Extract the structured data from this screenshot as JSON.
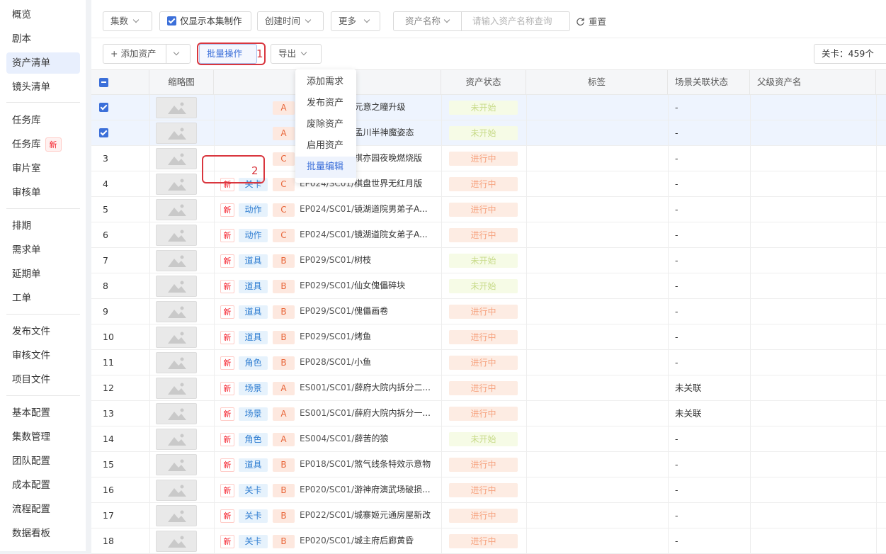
{
  "sidebar": {
    "items": [
      {
        "label": "概览"
      },
      {
        "label": "剧本"
      },
      {
        "label": "资产清单"
      },
      {
        "label": "镜头清单"
      },
      {
        "label": "任务库"
      },
      {
        "label": "任务库",
        "badge": "新"
      },
      {
        "label": "审片室"
      },
      {
        "label": "审核单"
      },
      {
        "label": "排期"
      },
      {
        "label": "需求单"
      },
      {
        "label": "延期单"
      },
      {
        "label": "工单"
      },
      {
        "label": "发布文件"
      },
      {
        "label": "审核文件"
      },
      {
        "label": "项目文件"
      },
      {
        "label": "基本配置"
      },
      {
        "label": "集数管理"
      },
      {
        "label": "团队配置"
      },
      {
        "label": "成本配置"
      },
      {
        "label": "流程配置"
      },
      {
        "label": "数据看板"
      }
    ]
  },
  "filters": {
    "episodes": "集数",
    "only_current": "仅显示本集制作",
    "created_time": "创建时间",
    "more": "更多",
    "search_field": "资产名称",
    "search_placeholder": "请输入资产名称查询",
    "reset": "重置"
  },
  "toolbar": {
    "add_asset": "+ 添加资产",
    "batch_ops": "批量操作",
    "export": "导出",
    "count": "关卡：459个",
    "callout1": "1",
    "callout2": "2"
  },
  "table": {
    "headers": {
      "thumb": "缩略图",
      "status": "资产状态",
      "tags": "标签",
      "scene_link": "场景关联状态",
      "parent": "父级资产名"
    },
    "rows": [
      {
        "no": "",
        "selected": true,
        "new": "",
        "type": "",
        "grade": "A",
        "code": "ES005/SC01/",
        "title": "元意之瞳升级",
        "status": "未开始",
        "link": "-"
      },
      {
        "no": "",
        "selected": true,
        "new": "",
        "type": "",
        "grade": "A",
        "code": "ES003/SC01/",
        "title": "孟川半神魔姿态",
        "status": "未开始",
        "link": "-"
      },
      {
        "no": "3",
        "new": "",
        "type": "",
        "grade": "C",
        "code": "EP024/SC01/",
        "title": "棋亦园夜晚燃烧版",
        "status": "进行中",
        "link": "-"
      },
      {
        "no": "4",
        "new": "新",
        "type": "关卡",
        "grade": "C",
        "code": "EP024/SC01/",
        "title": "棋盘世界无红月版",
        "status": "进行中",
        "link": "-"
      },
      {
        "no": "5",
        "new": "新",
        "type": "动作",
        "grade": "C",
        "code": "EP024/SC01/",
        "title": "镜湖道院男弟子A...",
        "status": "进行中",
        "link": "-"
      },
      {
        "no": "6",
        "new": "新",
        "type": "动作",
        "grade": "C",
        "code": "EP024/SC01/",
        "title": "镜湖道院女弟子A...",
        "status": "进行中",
        "link": "-"
      },
      {
        "no": "7",
        "new": "新",
        "type": "道具",
        "grade": "B",
        "code": "EP029/SC01/",
        "title": "树枝",
        "status": "未开始",
        "link": "-"
      },
      {
        "no": "8",
        "new": "新",
        "type": "道具",
        "grade": "B",
        "code": "EP029/SC01/",
        "title": "仙女傀儡碎块",
        "status": "未开始",
        "link": "-"
      },
      {
        "no": "9",
        "new": "新",
        "type": "道具",
        "grade": "B",
        "code": "EP029/SC01/",
        "title": "傀儡画卷",
        "status": "进行中",
        "link": "-"
      },
      {
        "no": "10",
        "new": "新",
        "type": "道具",
        "grade": "B",
        "code": "EP029/SC01/",
        "title": "烤鱼",
        "status": "进行中",
        "link": "-"
      },
      {
        "no": "11",
        "new": "新",
        "type": "角色",
        "grade": "B",
        "code": "EP028/SC01/",
        "title": "小鱼",
        "status": "进行中",
        "link": "-"
      },
      {
        "no": "12",
        "new": "新",
        "type": "场景",
        "grade": "A",
        "code": "ES001/SC01/",
        "title": "薛府大院内拆分二...",
        "status": "进行中",
        "link": "未关联"
      },
      {
        "no": "13",
        "new": "新",
        "type": "场景",
        "grade": "A",
        "code": "ES001/SC01/",
        "title": "薛府大院内拆分一...",
        "status": "进行中",
        "link": "未关联"
      },
      {
        "no": "14",
        "new": "新",
        "type": "角色",
        "grade": "A",
        "code": "ES004/SC01/",
        "title": "薛苦的狼",
        "status": "未开始",
        "link": "-"
      },
      {
        "no": "15",
        "new": "新",
        "type": "道具",
        "grade": "B",
        "code": "EP018/SC01/",
        "title": "煞气线条特效示意物",
        "status": "进行中",
        "link": "-"
      },
      {
        "no": "16",
        "new": "新",
        "type": "关卡",
        "grade": "B",
        "code": "EP020/SC01/",
        "title": "游神府演武场破损...",
        "status": "进行中",
        "link": "-"
      },
      {
        "no": "17",
        "new": "新",
        "type": "关卡",
        "grade": "B",
        "code": "EP022/SC01/",
        "title": "城寨姬元通房屋新改",
        "status": "进行中",
        "link": "-"
      },
      {
        "no": "18",
        "new": "新",
        "type": "关卡",
        "grade": "B",
        "code": "EP020/SC01/",
        "title": "城主府后廊黄昏",
        "status": "进行中",
        "link": "-"
      }
    ]
  },
  "dropdown": {
    "items": [
      "添加需求",
      "发布资产",
      "废除资产",
      "启用资产",
      "批量编辑"
    ]
  },
  "colors": {
    "accent": "#3b6fd9",
    "highlight": "#d9363e",
    "not_started": "#c8db8a",
    "in_progress": "#f6a27e"
  }
}
